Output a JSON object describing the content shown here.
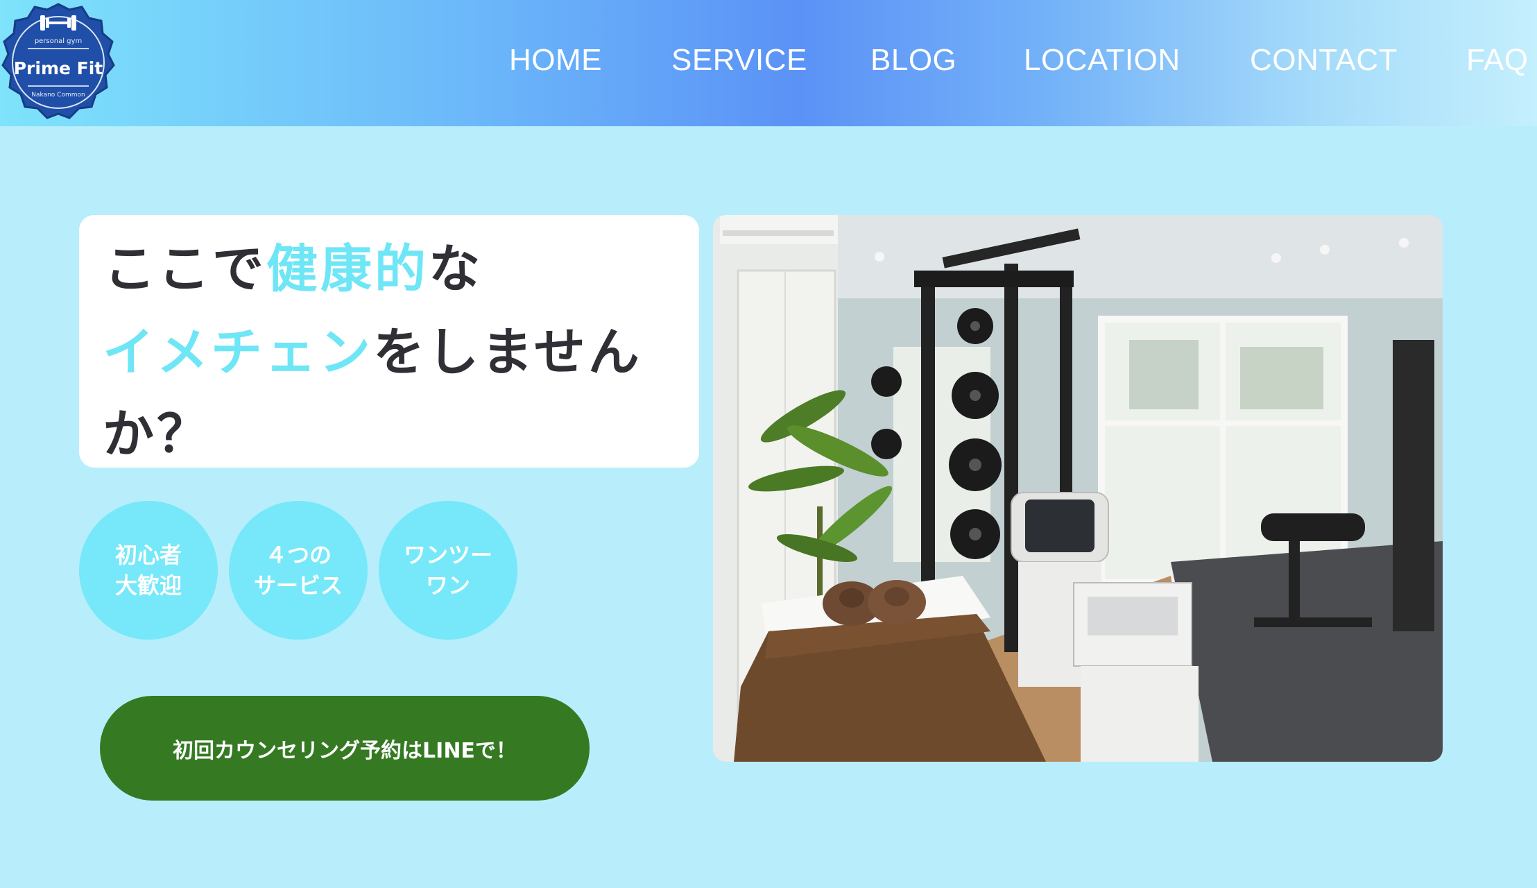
{
  "header": {
    "logo": {
      "top_text": "personal gym",
      "brand": "Prime Fit",
      "bottom_text": "Nakano Common",
      "icon": "dumbbell-icon"
    },
    "nav": [
      {
        "label": "HOME"
      },
      {
        "label": "SERVICE"
      },
      {
        "label": "BLOG"
      },
      {
        "label": "LOCATION"
      },
      {
        "label": "CONTACT"
      },
      {
        "label": "FAQ"
      }
    ]
  },
  "hero": {
    "line1": {
      "a": "ここで",
      "b": "健康的",
      "c": "な"
    },
    "line2": {
      "a": "イメチェン",
      "b": "をしません"
    },
    "line3": "か？",
    "badges": [
      {
        "l1": "初心者",
        "l2": "大歓迎"
      },
      {
        "l1": "４つの",
        "l2": "サービス"
      },
      {
        "l1": "ワンツー",
        "l2": "ワン"
      }
    ],
    "cta_label": "初回カウンセリング予約はLINEで！"
  },
  "colors": {
    "page_bg": "#b8eefc",
    "highlight": "#6ee6f6",
    "badge": "#76e8f9",
    "cta": "#357a23",
    "logo_badge": "#1f4fa8"
  }
}
